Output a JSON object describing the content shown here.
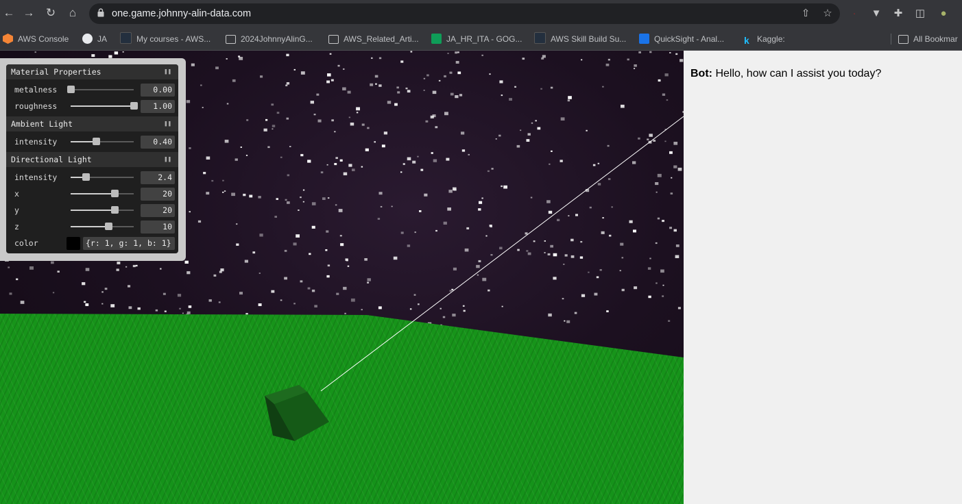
{
  "browser": {
    "url": "one.game.johnny-alin-data.com",
    "nav": {
      "back_icon": "arrow-left-icon",
      "forward_icon": "arrow-right-icon",
      "reload_icon": "reload-icon",
      "home_icon": "home-icon"
    },
    "bookmarks": [
      {
        "label": "AWS Console",
        "icon": "aws-cube-icon",
        "color": "#f58536"
      },
      {
        "label": "JA",
        "icon": "globe-icon",
        "color": "#ffffff"
      },
      {
        "label": "My courses - AWS...",
        "icon": "aws-logo-icon",
        "color": "#232f3e"
      },
      {
        "label": "2024JohnnyAlinG...",
        "icon": "folder-icon",
        "color": "#c6c7c8"
      },
      {
        "label": "AWS_Related_Arti...",
        "icon": "folder-icon",
        "color": "#c6c7c8"
      },
      {
        "label": "JA_HR_ITA - GOG...",
        "icon": "sheets-icon",
        "color": "#0f9d58"
      },
      {
        "label": "AWS Skill Build Su...",
        "icon": "aws-logo-icon",
        "color": "#232f3e"
      },
      {
        "label": "QuickSight - Anal...",
        "icon": "quicksight-icon",
        "color": "#1a73e8"
      },
      {
        "label": "Kaggle:",
        "icon": "kaggle-icon",
        "color": "#20beff"
      }
    ],
    "all_bookmarks": "All Bookmar"
  },
  "gui": {
    "material": {
      "title": "Material Properties",
      "metalness": {
        "label": "metalness",
        "value": "0.00",
        "fraction": 0.0
      },
      "roughness": {
        "label": "roughness",
        "value": "1.00",
        "fraction": 1.0
      }
    },
    "ambient": {
      "title": "Ambient Light",
      "intensity": {
        "label": "intensity",
        "value": "0.40",
        "fraction": 0.4
      }
    },
    "directional": {
      "title": "Directional Light",
      "intensity": {
        "label": "intensity",
        "value": "2.4",
        "fraction": 0.24
      },
      "x": {
        "label": "x",
        "value": "20",
        "fraction": 0.7
      },
      "y": {
        "label": "y",
        "value": "20",
        "fraction": 0.7
      },
      "z": {
        "label": "z",
        "value": "10",
        "fraction": 0.6
      },
      "color": {
        "label": "color",
        "value": "{r: 1, g: 1, b: 1}",
        "swatch": "#000000"
      }
    }
  },
  "chat": {
    "speaker": "Bot:",
    "message": "Hello, how can I assist you today?"
  },
  "colors": {
    "ground": "#18941a",
    "cube": "#15561a",
    "chat_bg": "#f0f0f0"
  }
}
